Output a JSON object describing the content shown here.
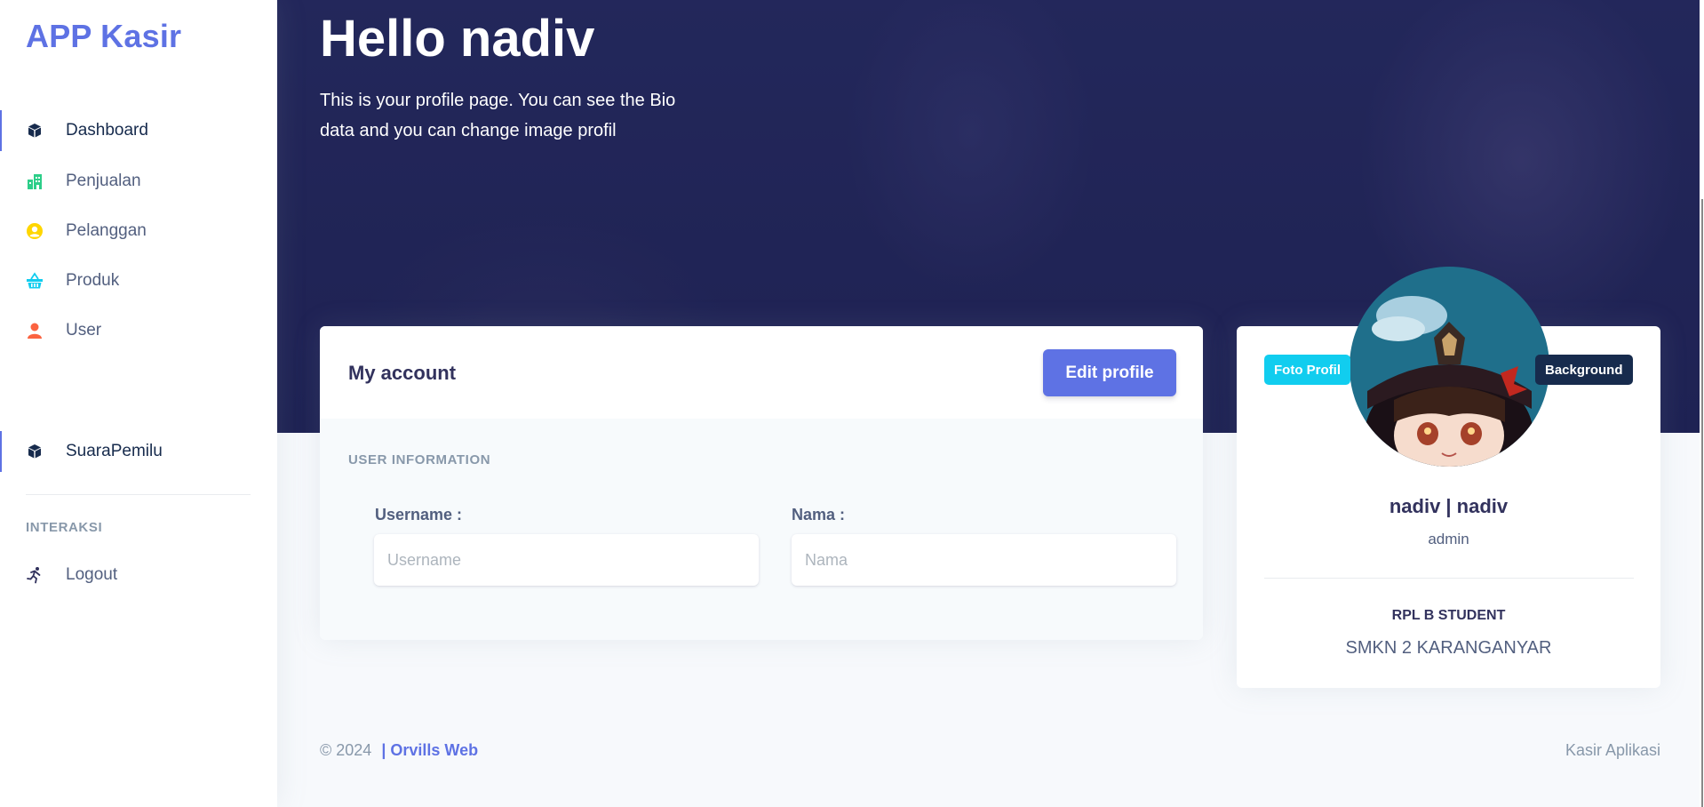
{
  "app": {
    "brand": "APP Kasir"
  },
  "sidebar": {
    "items": [
      {
        "label": "Dashboard",
        "icon": "box-icon",
        "active": true
      },
      {
        "label": "Penjualan",
        "icon": "building-icon",
        "active": false
      },
      {
        "label": "Pelanggan",
        "icon": "user-circle-icon",
        "active": false
      },
      {
        "label": "Produk",
        "icon": "basket-icon",
        "active": false
      },
      {
        "label": "User",
        "icon": "user-icon",
        "active": false
      },
      {
        "label": "SuaraPemilu",
        "icon": "box-icon",
        "active": true
      }
    ],
    "heading": "INTERAKSI",
    "logout": {
      "label": "Logout",
      "icon": "running-icon"
    }
  },
  "hero": {
    "title": "Hello nadiv",
    "description": "This is your profile page. You can see the Bio data and you can change image profil"
  },
  "account": {
    "title": "My account",
    "edit_label": "Edit profile",
    "section_heading": "USER INFORMATION",
    "username_label": "Username :",
    "username_placeholder": "Username",
    "nama_label": "Nama :",
    "nama_placeholder": "Nama"
  },
  "profile": {
    "photo_badge": "Foto Profil",
    "background_badge": "Background",
    "name": "nadiv | nadiv",
    "role": "admin",
    "class": "RPL B STUDENT",
    "school": "SMKN 2 KARANGANYAR"
  },
  "footer": {
    "copyright": "© 2024",
    "separator": "|",
    "link": "Orvills Web",
    "right": "Kasir Aplikasi"
  },
  "colors": {
    "primary": "#5e72e4",
    "info": "#11cdef",
    "dark": "#172b4d",
    "success": "#2dce89",
    "warning": "#ffd600",
    "danger": "#f5365c"
  }
}
